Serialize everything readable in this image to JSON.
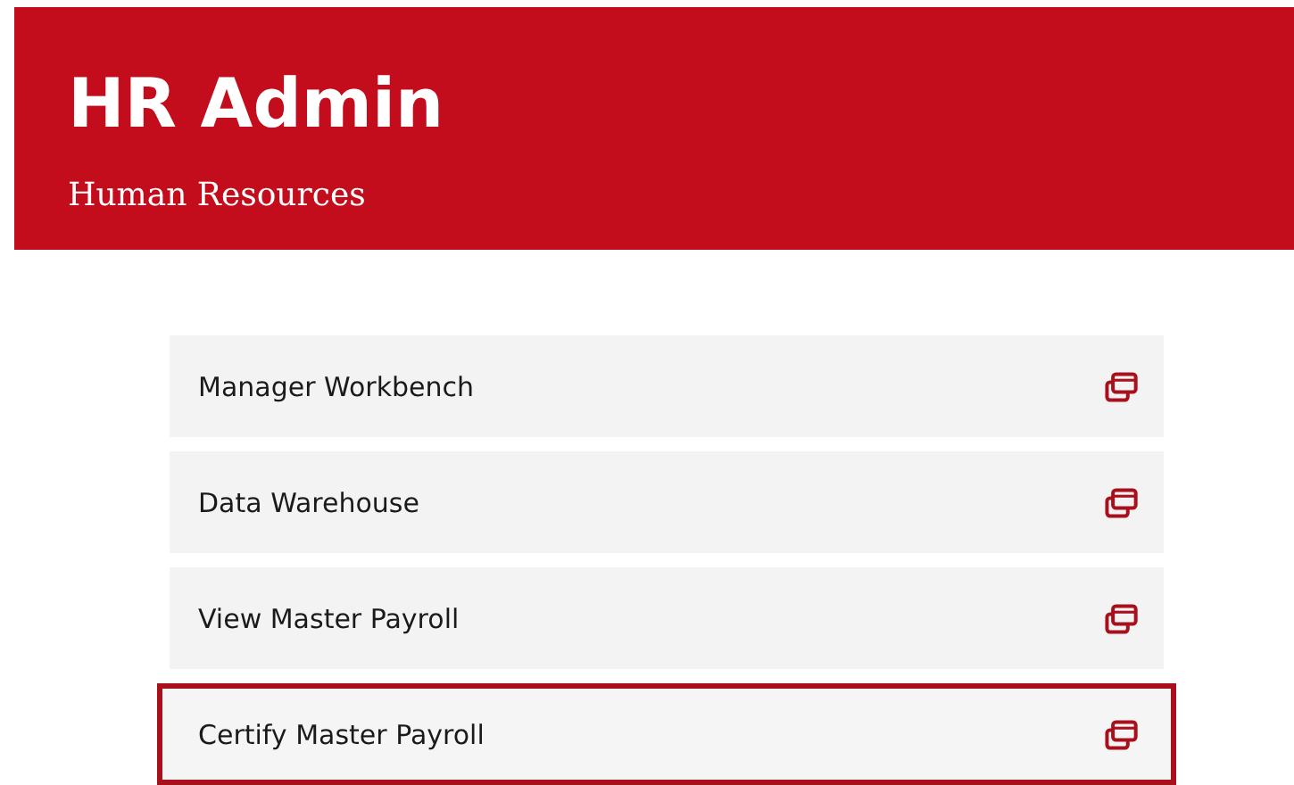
{
  "header": {
    "title": "HR Admin",
    "subtitle": "Human Resources"
  },
  "links": [
    {
      "label": "Manager Workbench",
      "selected": false
    },
    {
      "label": "Data Warehouse",
      "selected": false
    },
    {
      "label": "View Master Payroll",
      "selected": false
    },
    {
      "label": "Certify Master Payroll",
      "selected": true
    }
  ]
}
